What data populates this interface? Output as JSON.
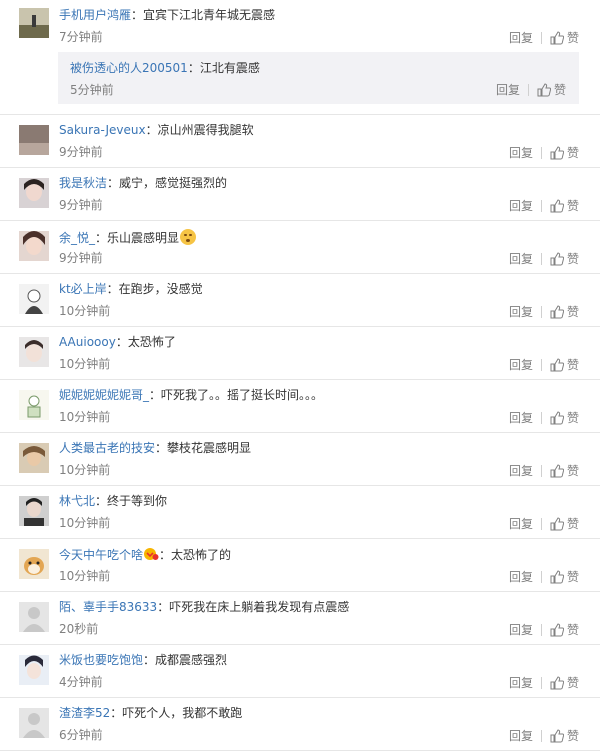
{
  "actions": {
    "reply_label": "回复",
    "like_label": "赞"
  },
  "colors": {
    "username": "#eb7350",
    "username_blue": "#3a75b5",
    "time": "#808080",
    "nested_bg": "#f2f2f5"
  },
  "comments": [
    {
      "user": "手机用户鸿雁",
      "text": "：宜宾下江北青年城无震感",
      "time": "7分钟前",
      "reply": {
        "user": "被伤透心的人200501",
        "text": "：江北有震感",
        "time": "5分钟前"
      }
    },
    {
      "user": "Sakura-Jeveux",
      "text": "：凉山州震得我腿软",
      "time": "9分钟前"
    },
    {
      "user": "我是秋洁",
      "text": "：威宁，感觉挺强烈的",
      "time": "9分钟前"
    },
    {
      "user": "余_悦_",
      "text": "：乐山震感明显",
      "time": "9分钟前",
      "emoji": "flushed-emoji"
    },
    {
      "user": "kt必上岸",
      "text": "：在跑步，没感觉",
      "time": "10分钟前"
    },
    {
      "user": "AAuioooy",
      "text": "：太恐怖了",
      "time": "10分钟前"
    },
    {
      "user": "妮妮妮妮妮妮哥_",
      "text": "：吓死我了。。摇了挺长时间。。。",
      "time": "10分钟前"
    },
    {
      "user": "人类最古老的技安",
      "text": "：攀枝花震感明显",
      "time": "10分钟前"
    },
    {
      "user": "林弋北",
      "text": "：终于等到你",
      "time": "10分钟前"
    },
    {
      "user": "今天中午吃个啥",
      "text": "：太恐怖了的",
      "time": "10分钟前",
      "badge": "vip-badge"
    },
    {
      "user": "陌、辜手手83633",
      "text": "：吓死我在床上躺着我发现有点震感",
      "time": "20秒前"
    },
    {
      "user": "米饭也要吃饱饱",
      "text": "：成都震感强烈",
      "time": "4分钟前"
    },
    {
      "user": "渣渣李52",
      "text": "：吓死个人，我都不敢跑",
      "time": "6分钟前"
    }
  ]
}
